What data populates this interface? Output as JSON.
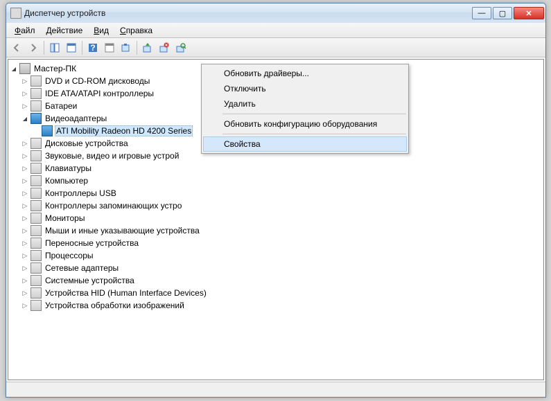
{
  "window": {
    "title": "Диспетчер устройств"
  },
  "menu": {
    "file": "Файл",
    "action": "Действие",
    "view": "Вид",
    "help": "Справка"
  },
  "tree": {
    "root": "Мастер-ПК",
    "items": [
      "DVD и CD-ROM дисководы",
      "IDE ATA/ATAPI контроллеры",
      "Батареи"
    ],
    "video_adapters": "Видеоадаптеры",
    "selected_device": "ATI Mobility Radeon HD 4200 Series",
    "items2": [
      "Дисковые устройства",
      "Звуковые, видео и игровые устрой",
      "Клавиатуры",
      "Компьютер",
      "Контроллеры USB",
      "Контроллеры запоминающих устро",
      "Мониторы",
      "Мыши и иные указывающие устройства",
      "Переносные устройства",
      "Процессоры",
      "Сетевые адаптеры",
      "Системные устройства",
      "Устройства HID (Human Interface Devices)",
      "Устройства обработки изображений"
    ]
  },
  "ctx": {
    "update": "Обновить драйверы...",
    "disable": "Отключить",
    "delete": "Удалить",
    "scan": "Обновить конфигурацию оборудования",
    "props": "Свойства"
  }
}
